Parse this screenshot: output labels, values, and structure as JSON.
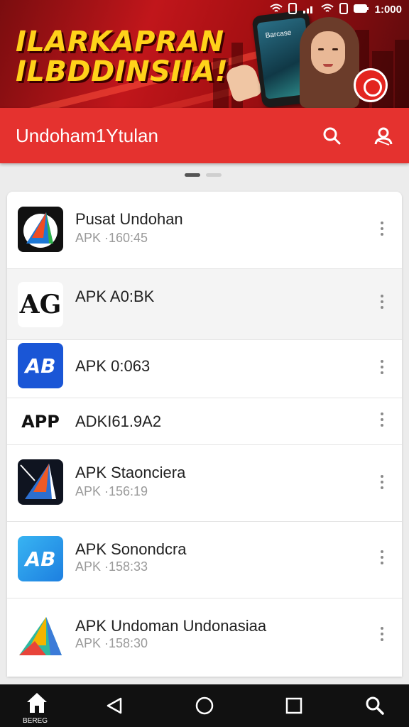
{
  "status_bar": {
    "time": "1:000"
  },
  "banner": {
    "title_line1": "ILARKAPRAN",
    "title_line2": "ILBDDINSIIA!",
    "phone_label": "Barcase"
  },
  "appbar": {
    "title": "Undoham1Ytulan"
  },
  "list": {
    "items": [
      {
        "title": "Pusat Undohan",
        "subtitle": "APK ·160:45",
        "icon": "triangle-logo-icon",
        "icon_text": ""
      },
      {
        "title": "APK A0:BK",
        "subtitle": "",
        "icon": "ag-logo-icon",
        "icon_text": "AG"
      },
      {
        "title": "APK 0:063",
        "subtitle": "",
        "icon": "ab-logo-icon",
        "icon_text": "AB"
      },
      {
        "title": "ADKI61.9A2",
        "subtitle": "",
        "icon": "app-text-icon",
        "icon_text": "APP"
      },
      {
        "title": "APK Staonciera",
        "subtitle": "APK ·156:19",
        "icon": "triangle-dark-logo-icon",
        "icon_text": ""
      },
      {
        "title": "APK Sonondcra",
        "subtitle": "APK ·158:33",
        "icon": "ab-light-logo-icon",
        "icon_text": "AB"
      },
      {
        "title": "APK Undoman Undonasiaa",
        "subtitle": "APK ·158:30",
        "icon": "play-triangle-icon",
        "icon_text": ""
      }
    ]
  },
  "navbar": {
    "home_label": "BEREG"
  },
  "colors": {
    "accent": "#e5322f",
    "banner_text": "#ffd21a",
    "navbar": "#111111"
  }
}
